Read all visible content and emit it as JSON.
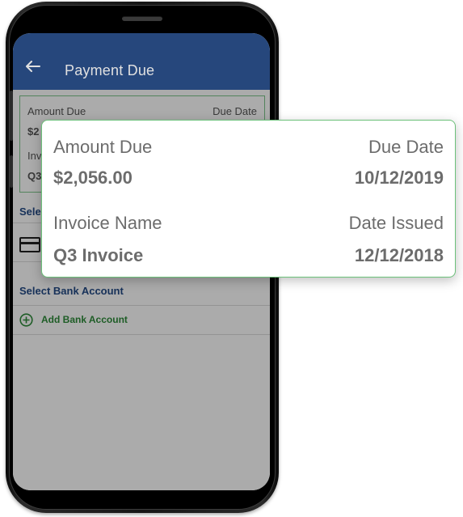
{
  "app_bar": {
    "title": "Payment Due"
  },
  "mini_card": {
    "amount_label": "Amount Due",
    "due_label": "Due Date",
    "amount_value_partial": "$2",
    "invoice_label_partial": "Inv",
    "invoice_value_partial": "Q3"
  },
  "sections": {
    "select_card_partial": "Sele",
    "select_bank_account": "Select Bank Account",
    "add_bank_account": "Add Bank Account"
  },
  "zoom_card": {
    "amount_due_label": "Amount Due",
    "amount_due_value": "$2,056.00",
    "due_date_label": "Due Date",
    "due_date_value": "10/12/2019",
    "invoice_name_label": "Invoice Name",
    "invoice_name_value": "Q3 Invoice",
    "date_issued_label": "Date Issued",
    "date_issued_value": "12/12/2018"
  },
  "colors": {
    "app_bar": "#2c518e",
    "section_title": "#244b86",
    "accent_green": "#2e8b3a",
    "card_border": "#6cc07a"
  },
  "icons": {
    "back": "arrow-left-icon",
    "card": "credit-card-icon",
    "add": "plus-circle-icon"
  }
}
